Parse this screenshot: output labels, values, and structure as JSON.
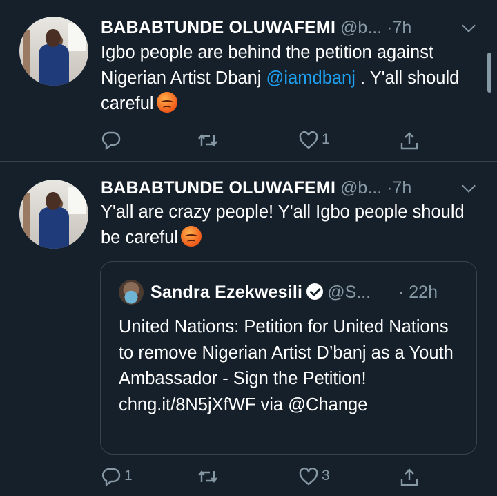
{
  "tweets": [
    {
      "author": "BABABTUNDE OLUWAFEMI",
      "handle": "@b...",
      "separator": "·",
      "time": "7h",
      "text_before": "Igbo people are behind the petition against Nigerian Artist Dbanj ",
      "mention": "@iamdbanj",
      "text_after": " . Y'all should careful",
      "emoji": "angry-face",
      "actions": {
        "reply_count": "",
        "retweet_count": "",
        "like_count": "1"
      }
    },
    {
      "author": "BABABTUNDE OLUWAFEMI",
      "handle": "@b...",
      "separator": "·",
      "time": "7h",
      "text": "Y'all are crazy people! Y'all Igbo people should be careful",
      "emoji": "angry-face",
      "quoted": {
        "author": "Sandra Ezekwesili",
        "handle": "@S...",
        "separator": "·",
        "time": "22h",
        "text": "United Nations: Petition for United Nations to remove Nigerian Artist D’banj as a Youth Ambassador - Sign the Petition! chng.it/8N5jXfWF via @Change"
      },
      "actions": {
        "reply_count": "1",
        "retweet_count": "",
        "like_count": "3"
      }
    }
  ],
  "icons": [
    "reply-icon",
    "retweet-icon",
    "like-icon",
    "share-icon",
    "chevron-down-icon",
    "verified-icon"
  ],
  "colors": {
    "background": "#15202b",
    "secondary_text": "#8899a6",
    "link": "#1da1f2",
    "divider": "#38444d"
  }
}
